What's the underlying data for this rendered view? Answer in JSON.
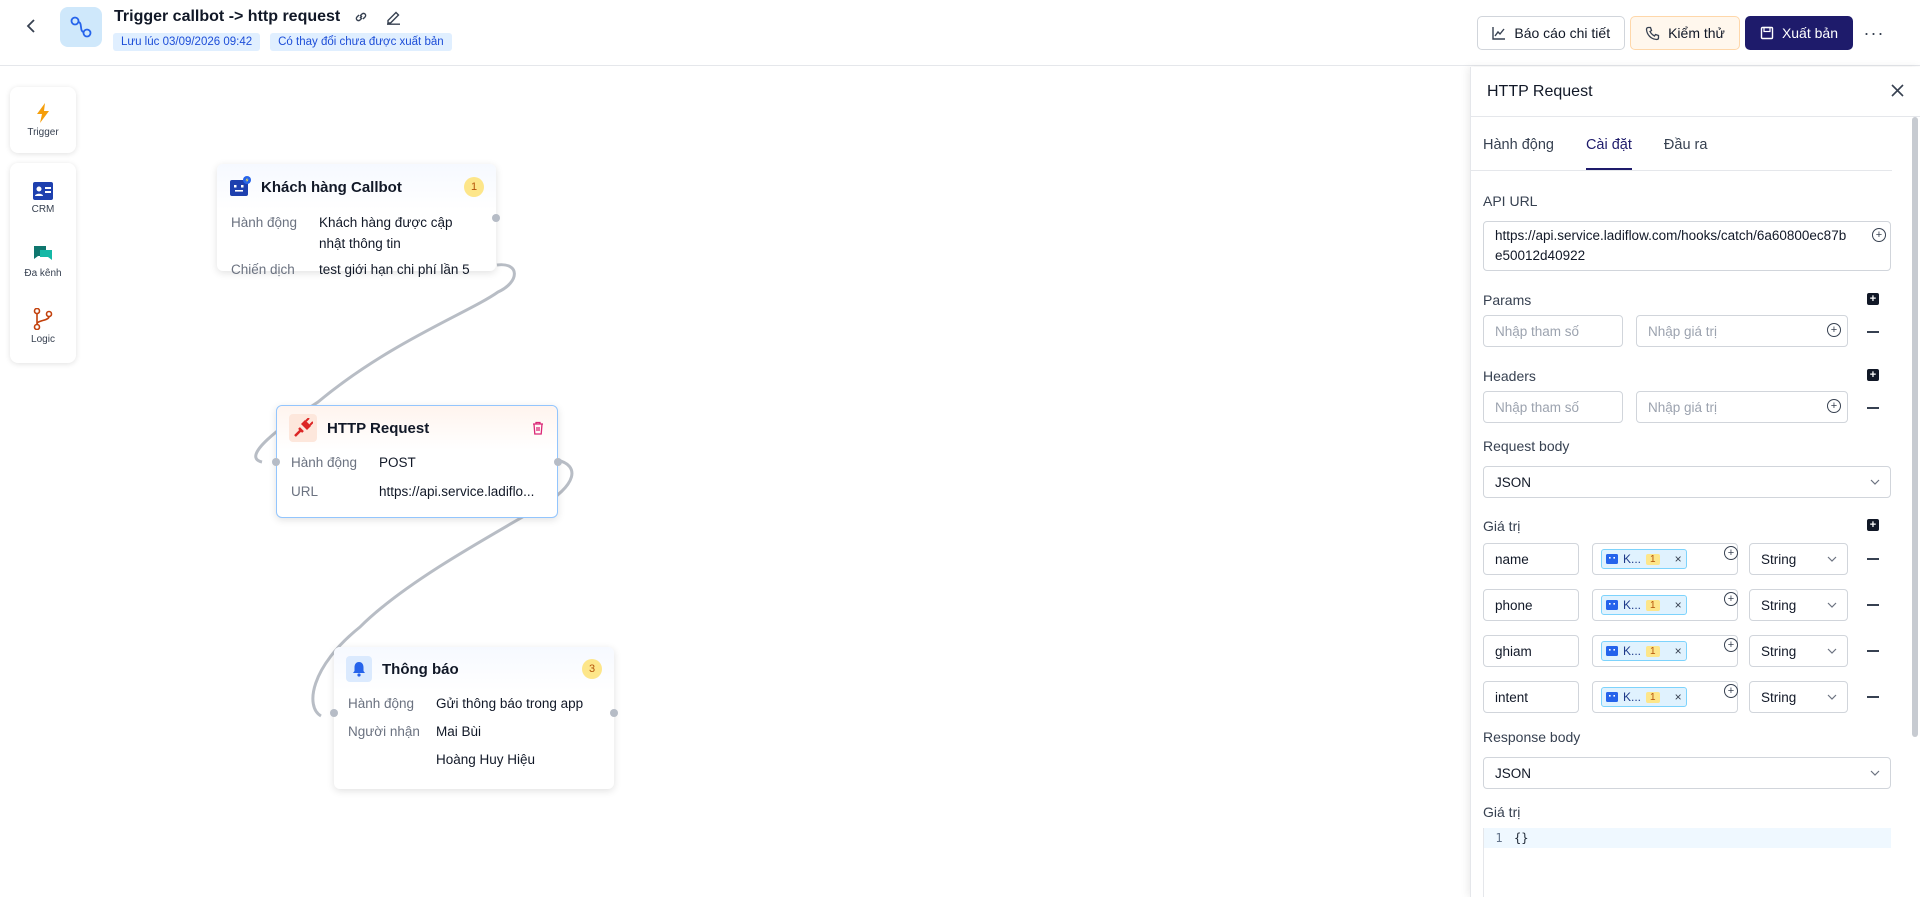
{
  "header": {
    "title": "Trigger callbot -> http request",
    "saved_at": "Lưu lúc 03/09/2026 09:42",
    "unpublished": "Có thay đổi chưa được xuất bản",
    "report_label": "Báo cáo chi tiết",
    "test_label": "Kiểm thử",
    "publish_label": "Xuất bản",
    "more": "···"
  },
  "toolbox": {
    "trigger": "Trigger",
    "crm": "CRM",
    "multichannel": "Đa kênh",
    "logic": "Logic"
  },
  "nodes": {
    "callbot": {
      "title": "Khách hàng Callbot",
      "badge": "1",
      "action_label": "Hành động",
      "action_value": "Khách hàng được cập nhật thông tin",
      "campaign_label": "Chiến dịch",
      "campaign_value": "test giới hạn chi phí lần 5"
    },
    "http": {
      "title": "HTTP Request",
      "action_label": "Hành động",
      "action_value": "POST",
      "url_label": "URL",
      "url_value": "https://api.service.ladiflo..."
    },
    "notify": {
      "title": "Thông báo",
      "badge": "3",
      "action_label": "Hành động",
      "action_value": "Gửi thông báo trong app",
      "recipient_label": "Người nhận",
      "recipient_1": "Mai Bùi",
      "recipient_2": "Hoàng Huy Hiệu"
    }
  },
  "panel": {
    "title": "HTTP Request",
    "tabs": [
      "Hành động",
      "Cài đặt",
      "Đầu ra"
    ],
    "api_url_label": "API URL",
    "api_url_line1": "https://api.service.ladiflow.com/hooks/catch/6a60800ec87b",
    "api_url_line2": "e50012d40922",
    "params_label": "Params",
    "headers_label": "Headers",
    "key_placeholder": "Nhập tham số",
    "value_placeholder": "Nhập giá trị",
    "request_body_label": "Request body",
    "request_body_type": "JSON",
    "values_label": "Giá trị",
    "body_rows": [
      {
        "key": "name",
        "chip": "K...",
        "chip_num": "1",
        "type": "String"
      },
      {
        "key": "phone",
        "chip": "K...",
        "chip_num": "1",
        "type": "String"
      },
      {
        "key": "ghiam",
        "chip": "K...",
        "chip_num": "1",
        "type": "String"
      },
      {
        "key": "intent",
        "chip": "K...",
        "chip_num": "1",
        "type": "String"
      }
    ],
    "response_body_label": "Response body",
    "response_body_type": "JSON",
    "response_values_label": "Giá trị",
    "code_line_no": "1",
    "code_line": "{}"
  }
}
